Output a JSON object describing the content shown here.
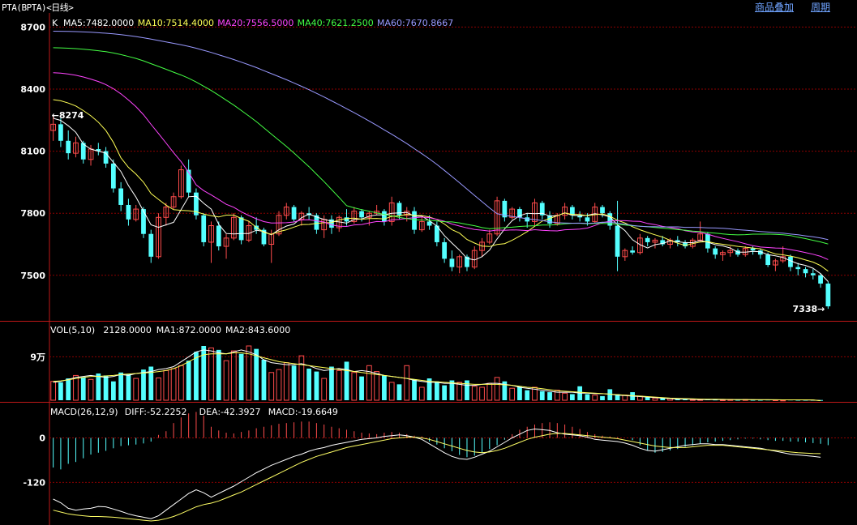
{
  "window": {
    "title": "PTA(BPTA)<日线>",
    "links": [
      "商品叠加",
      "周期"
    ]
  },
  "colors": {
    "up": "#ff4c4c",
    "down": "#54ffff",
    "grid": "#8b0000",
    "axis_text": "#ffffff",
    "ma5": "#ffffff",
    "ma10": "#ffff55",
    "ma20": "#ff44ff",
    "ma40": "#44ff44",
    "ma60": "#9999ff",
    "diff": "#ffffff",
    "dea": "#ffff66"
  },
  "chart_data": [
    {
      "type": "candlestick",
      "panel": "price",
      "prefix": "K",
      "indicators": [
        {
          "name": "MA5",
          "value": "7482.0000"
        },
        {
          "name": "MA10",
          "value": "7514.4000"
        },
        {
          "name": "MA20",
          "value": "7556.5000"
        },
        {
          "name": "MA40",
          "value": "7621.2500"
        },
        {
          "name": "MA60",
          "value": "7670.8667"
        }
      ],
      "y_ticks": [
        8700,
        8400,
        8100,
        7800,
        7500
      ],
      "ylim": [
        7280,
        8760
      ],
      "annotations": [
        {
          "text": "8274",
          "x": 0,
          "y": 8274
        },
        {
          "text": "7338",
          "x": 81,
          "y": 7338
        }
      ],
      "ohlc": [
        [
          8200,
          8274,
          8150,
          8230
        ],
        [
          8230,
          8260,
          8120,
          8150
        ],
        [
          8150,
          8200,
          8060,
          8090
        ],
        [
          8090,
          8170,
          8070,
          8140
        ],
        [
          8140,
          8150,
          8040,
          8060
        ],
        [
          8060,
          8130,
          8030,
          8110
        ],
        [
          8110,
          8140,
          8080,
          8100
        ],
        [
          8100,
          8120,
          8020,
          8040
        ],
        [
          8040,
          8060,
          7900,
          7920
        ],
        [
          7920,
          7950,
          7810,
          7840
        ],
        [
          7840,
          7870,
          7740,
          7770
        ],
        [
          7770,
          7840,
          7760,
          7820
        ],
        [
          7820,
          7830,
          7680,
          7700
        ],
        [
          7700,
          7720,
          7560,
          7590
        ],
        [
          7590,
          7800,
          7580,
          7780
        ],
        [
          7780,
          7850,
          7740,
          7830
        ],
        [
          7830,
          7900,
          7820,
          7880
        ],
        [
          7880,
          8030,
          7870,
          8010
        ],
        [
          8010,
          8060,
          7880,
          7900
        ],
        [
          7900,
          7920,
          7770,
          7790
        ],
        [
          7790,
          7800,
          7640,
          7660
        ],
        [
          7660,
          7760,
          7560,
          7740
        ],
        [
          7740,
          7760,
          7620,
          7640
        ],
        [
          7640,
          7700,
          7580,
          7680
        ],
        [
          7680,
          7800,
          7670,
          7780
        ],
        [
          7780,
          7790,
          7650,
          7670
        ],
        [
          7670,
          7760,
          7660,
          7740
        ],
        [
          7740,
          7780,
          7700,
          7720
        ],
        [
          7720,
          7730,
          7640,
          7650
        ],
        [
          7650,
          7720,
          7560,
          7700
        ],
        [
          7700,
          7810,
          7690,
          7790
        ],
        [
          7790,
          7850,
          7770,
          7830
        ],
        [
          7830,
          7840,
          7760,
          7770
        ],
        [
          7770,
          7810,
          7740,
          7800
        ],
        [
          7800,
          7830,
          7770,
          7790
        ],
        [
          7790,
          7800,
          7700,
          7720
        ],
        [
          7720,
          7790,
          7680,
          7770
        ],
        [
          7770,
          7790,
          7700,
          7730
        ],
        [
          7730,
          7790,
          7710,
          7780
        ],
        [
          7780,
          7820,
          7740,
          7760
        ],
        [
          7760,
          7830,
          7750,
          7810
        ],
        [
          7810,
          7820,
          7760,
          7780
        ],
        [
          7780,
          7810,
          7740,
          7800
        ],
        [
          7800,
          7840,
          7790,
          7810
        ],
        [
          7810,
          7820,
          7740,
          7760
        ],
        [
          7760,
          7880,
          7740,
          7850
        ],
        [
          7850,
          7860,
          7770,
          7790
        ],
        [
          7790,
          7830,
          7760,
          7810
        ],
        [
          7810,
          7830,
          7700,
          7720
        ],
        [
          7720,
          7780,
          7710,
          7760
        ],
        [
          7760,
          7790,
          7720,
          7740
        ],
        [
          7740,
          7760,
          7640,
          7660
        ],
        [
          7660,
          7680,
          7560,
          7580
        ],
        [
          7580,
          7620,
          7520,
          7540
        ],
        [
          7540,
          7600,
          7510,
          7590
        ],
        [
          7590,
          7600,
          7520,
          7540
        ],
        [
          7540,
          7640,
          7530,
          7620
        ],
        [
          7620,
          7680,
          7590,
          7660
        ],
        [
          7660,
          7720,
          7650,
          7700
        ],
        [
          7700,
          7880,
          7690,
          7860
        ],
        [
          7860,
          7870,
          7760,
          7780
        ],
        [
          7780,
          7830,
          7770,
          7820
        ],
        [
          7820,
          7830,
          7760,
          7780
        ],
        [
          7780,
          7800,
          7730,
          7760
        ],
        [
          7760,
          7870,
          7740,
          7850
        ],
        [
          7850,
          7860,
          7770,
          7790
        ],
        [
          7790,
          7810,
          7730,
          7750
        ],
        [
          7750,
          7800,
          7740,
          7790
        ],
        [
          7790,
          7850,
          7770,
          7830
        ],
        [
          7830,
          7840,
          7770,
          7790
        ],
        [
          7790,
          7810,
          7760,
          7780
        ],
        [
          7780,
          7800,
          7740,
          7760
        ],
        [
          7760,
          7850,
          7750,
          7830
        ],
        [
          7830,
          7840,
          7780,
          7800
        ],
        [
          7800,
          7810,
          7720,
          7740
        ],
        [
          7740,
          7860,
          7520,
          7590
        ],
        [
          7590,
          7630,
          7570,
          7620
        ],
        [
          7620,
          7640,
          7600,
          7610
        ],
        [
          7610,
          7700,
          7600,
          7680
        ],
        [
          7680,
          7690,
          7640,
          7660
        ],
        [
          7660,
          7680,
          7630,
          7670
        ],
        [
          7670,
          7690,
          7640,
          7650
        ],
        [
          7650,
          7680,
          7630,
          7670
        ],
        [
          7670,
          7690,
          7640,
          7660
        ],
        [
          7660,
          7670,
          7630,
          7640
        ],
        [
          7640,
          7680,
          7630,
          7670
        ],
        [
          7670,
          7760,
          7660,
          7700
        ],
        [
          7700,
          7710,
          7610,
          7630
        ],
        [
          7630,
          7640,
          7580,
          7600
        ],
        [
          7600,
          7620,
          7570,
          7610
        ],
        [
          7610,
          7640,
          7590,
          7620
        ],
        [
          7620,
          7630,
          7590,
          7600
        ],
        [
          7600,
          7640,
          7590,
          7630
        ],
        [
          7630,
          7640,
          7600,
          7620
        ],
        [
          7620,
          7630,
          7580,
          7600
        ],
        [
          7600,
          7610,
          7540,
          7550
        ],
        [
          7550,
          7580,
          7520,
          7570
        ],
        [
          7570,
          7640,
          7560,
          7590
        ],
        [
          7590,
          7600,
          7520,
          7540
        ],
        [
          7540,
          7560,
          7500,
          7530
        ],
        [
          7530,
          7540,
          7490,
          7510
        ],
        [
          7510,
          7530,
          7480,
          7500
        ],
        [
          7500,
          7510,
          7440,
          7460
        ],
        [
          7460,
          7470,
          7338,
          7350
        ]
      ],
      "ma_values": {
        "MA5": "7482.0000",
        "MA10": "7514.4000",
        "MA20": "7556.5000",
        "MA40": "7621.2500",
        "MA60": "7670.8667"
      }
    },
    {
      "type": "bar",
      "panel": "volume",
      "title": "VOL(5,10)",
      "indicators": [
        {
          "name": "",
          "value": "2128.0000"
        },
        {
          "name": "MA1",
          "value": "872.0000"
        },
        {
          "name": "MA2",
          "value": "843.6000"
        }
      ],
      "y_ticks_label": [
        {
          "text": "9万",
          "value": 90000
        }
      ],
      "ylim": [
        0,
        140000
      ],
      "values": [
        40000,
        38000,
        46000,
        52000,
        48000,
        44000,
        56000,
        52000,
        40000,
        58000,
        55000,
        46000,
        64000,
        70000,
        47000,
        62000,
        66000,
        72000,
        82000,
        100000,
        112000,
        108000,
        104000,
        82000,
        102000,
        96000,
        112000,
        106000,
        84000,
        58000,
        64000,
        78000,
        72000,
        92000,
        66000,
        60000,
        46000,
        70000,
        62000,
        80000,
        58000,
        50000,
        72000,
        60000,
        52000,
        38000,
        34000,
        72000,
        44000,
        28000,
        46000,
        40000,
        32000,
        42000,
        38000,
        42000,
        30000,
        28000,
        36000,
        48000,
        40000,
        26000,
        30000,
        22000,
        28000,
        20000,
        18000,
        22000,
        16000,
        14000,
        30000,
        14000,
        12000,
        10000,
        24000,
        14000,
        12000,
        18000,
        10000,
        8000,
        6000,
        6000,
        5000,
        5000,
        4000,
        3000,
        3000,
        4000,
        3000,
        2500,
        3000,
        2500,
        3000,
        2500,
        2500,
        3000,
        2500,
        2000,
        3000,
        2500,
        2500,
        2500,
        2128
      ],
      "ma1": [
        38000,
        40000,
        44000,
        48000,
        50000,
        52000,
        50000,
        48000,
        50000,
        54000,
        52000,
        56000,
        58000,
        60000,
        64000,
        66000,
        70000,
        80000,
        90000,
        100000,
        104000,
        102000,
        98000,
        96000,
        100000,
        104000,
        100000,
        94000,
        84000,
        78000,
        76000,
        74000,
        74000,
        76000,
        72000,
        66000,
        62000,
        64000,
        66000,
        64000,
        60000,
        62000,
        60000,
        56000,
        52000,
        50000,
        48000,
        46000,
        42000,
        40000,
        38000,
        38000,
        36000,
        36000,
        34000,
        32000,
        32000,
        34000,
        36000,
        36000,
        34000,
        32000,
        28000,
        26000,
        24000,
        22000,
        20000,
        18000,
        18000,
        18000,
        16000,
        16000,
        15000,
        15000,
        14000,
        12000,
        11000,
        10000,
        9000,
        8000,
        7000,
        6000,
        5000,
        4000,
        4000,
        3500,
        3000,
        3000,
        3000,
        3000,
        3000,
        2800,
        2800,
        2600,
        2600,
        2600,
        2500,
        2500,
        2400,
        2400,
        2300,
        2200,
        872
      ],
      "ma2": [
        40000,
        41000,
        43000,
        46000,
        48000,
        50000,
        50000,
        51000,
        52000,
        54000,
        55000,
        56000,
        57000,
        58000,
        60000,
        62000,
        66000,
        72000,
        80000,
        88000,
        94000,
        96000,
        96000,
        96000,
        98000,
        98000,
        96000,
        92000,
        88000,
        84000,
        80000,
        78000,
        76000,
        74000,
        72000,
        70000,
        68000,
        66000,
        64000,
        62000,
        60000,
        58000,
        56000,
        54000,
        52000,
        50000,
        48000,
        46000,
        44000,
        42000,
        40000,
        39000,
        38000,
        37000,
        36000,
        35000,
        34000,
        34000,
        34000,
        34000,
        33000,
        32000,
        30000,
        28000,
        27000,
        25000,
        23000,
        21000,
        20000,
        19000,
        18000,
        17000,
        16000,
        15000,
        14000,
        13000,
        12000,
        11000,
        10000,
        9000,
        8000,
        7000,
        6000,
        5500,
        5000,
        4500,
        4000,
        3800,
        3600,
        3400,
        3200,
        3000,
        2900,
        2800,
        2700,
        2600,
        2600,
        2500,
        2500,
        2400,
        2400,
        2300,
        843.6
      ]
    },
    {
      "type": "bar",
      "panel": "macd",
      "title": "MACD(26,12,9)",
      "indicators": [
        {
          "name": "DIFF",
          "value": "-52.2252"
        },
        {
          "name": "DEA",
          "value": "-42.3927"
        },
        {
          "name": "MACD",
          "value": "-19.6649"
        }
      ],
      "y_ticks": [
        0,
        -120
      ],
      "ylim": [
        -235,
        95
      ],
      "values": [
        -80,
        -85,
        -70,
        -65,
        -55,
        -45,
        -40,
        -35,
        -28,
        -22,
        -20,
        -18,
        -15,
        -10,
        8,
        18,
        40,
        55,
        66,
        70,
        60,
        30,
        20,
        14,
        12,
        16,
        20,
        26,
        30,
        34,
        38,
        40,
        42,
        44,
        44,
        40,
        36,
        30,
        26,
        22,
        18,
        14,
        12,
        10,
        14,
        16,
        14,
        10,
        6,
        4,
        -10,
        -18,
        -28,
        -36,
        -46,
        -52,
        -48,
        -40,
        -30,
        -20,
        -5,
        10,
        22,
        30,
        36,
        40,
        42,
        40,
        36,
        30,
        24,
        16,
        10,
        6,
        4,
        2,
        0,
        -6,
        -20,
        -34,
        -40,
        -38,
        -34,
        -30,
        -24,
        -20,
        -16,
        -12,
        -10,
        -8,
        -6,
        -4,
        -2,
        -2,
        -4,
        -6,
        -8,
        -8,
        -10,
        -10,
        -12,
        -14,
        -16,
        -19.6649
      ],
      "diff": [
        -165,
        -175,
        -190,
        -195,
        -192,
        -190,
        -185,
        -186,
        -192,
        -198,
        -205,
        -210,
        -214,
        -218,
        -210,
        -195,
        -180,
        -165,
        -150,
        -140,
        -148,
        -160,
        -150,
        -140,
        -130,
        -118,
        -106,
        -94,
        -84,
        -74,
        -66,
        -58,
        -50,
        -44,
        -36,
        -30,
        -26,
        -20,
        -16,
        -12,
        -8,
        -4,
        -2,
        0,
        4,
        6,
        8,
        6,
        2,
        -4,
        -16,
        -28,
        -40,
        -50,
        -56,
        -58,
        -52,
        -44,
        -36,
        -24,
        -12,
        0,
        10,
        20,
        24,
        22,
        20,
        14,
        10,
        8,
        6,
        2,
        -4,
        -6,
        -8,
        -10,
        -14,
        -20,
        -28,
        -34,
        -36,
        -32,
        -28,
        -24,
        -20,
        -18,
        -16,
        -16,
        -18,
        -18,
        -20,
        -22,
        -24,
        -26,
        -28,
        -32,
        -36,
        -40,
        -44,
        -46,
        -48,
        -50,
        -52.2252
      ],
      "dea": [
        -195,
        -200,
        -205,
        -208,
        -210,
        -212,
        -212,
        -213,
        -214,
        -216,
        -218,
        -220,
        -222,
        -224,
        -222,
        -218,
        -212,
        -204,
        -195,
        -186,
        -180,
        -176,
        -170,
        -162,
        -154,
        -146,
        -136,
        -126,
        -116,
        -106,
        -96,
        -86,
        -76,
        -66,
        -58,
        -50,
        -44,
        -38,
        -32,
        -26,
        -22,
        -18,
        -14,
        -10,
        -6,
        -2,
        0,
        2,
        2,
        0,
        -4,
        -10,
        -16,
        -22,
        -28,
        -34,
        -38,
        -40,
        -38,
        -34,
        -28,
        -20,
        -12,
        -4,
        2,
        6,
        10,
        12,
        12,
        10,
        8,
        6,
        4,
        2,
        0,
        -2,
        -6,
        -10,
        -14,
        -18,
        -22,
        -24,
        -26,
        -26,
        -26,
        -24,
        -22,
        -20,
        -20,
        -20,
        -22,
        -24,
        -26,
        -28,
        -30,
        -32,
        -34,
        -36,
        -38,
        -40,
        -41,
        -42,
        -42.3927
      ]
    }
  ]
}
